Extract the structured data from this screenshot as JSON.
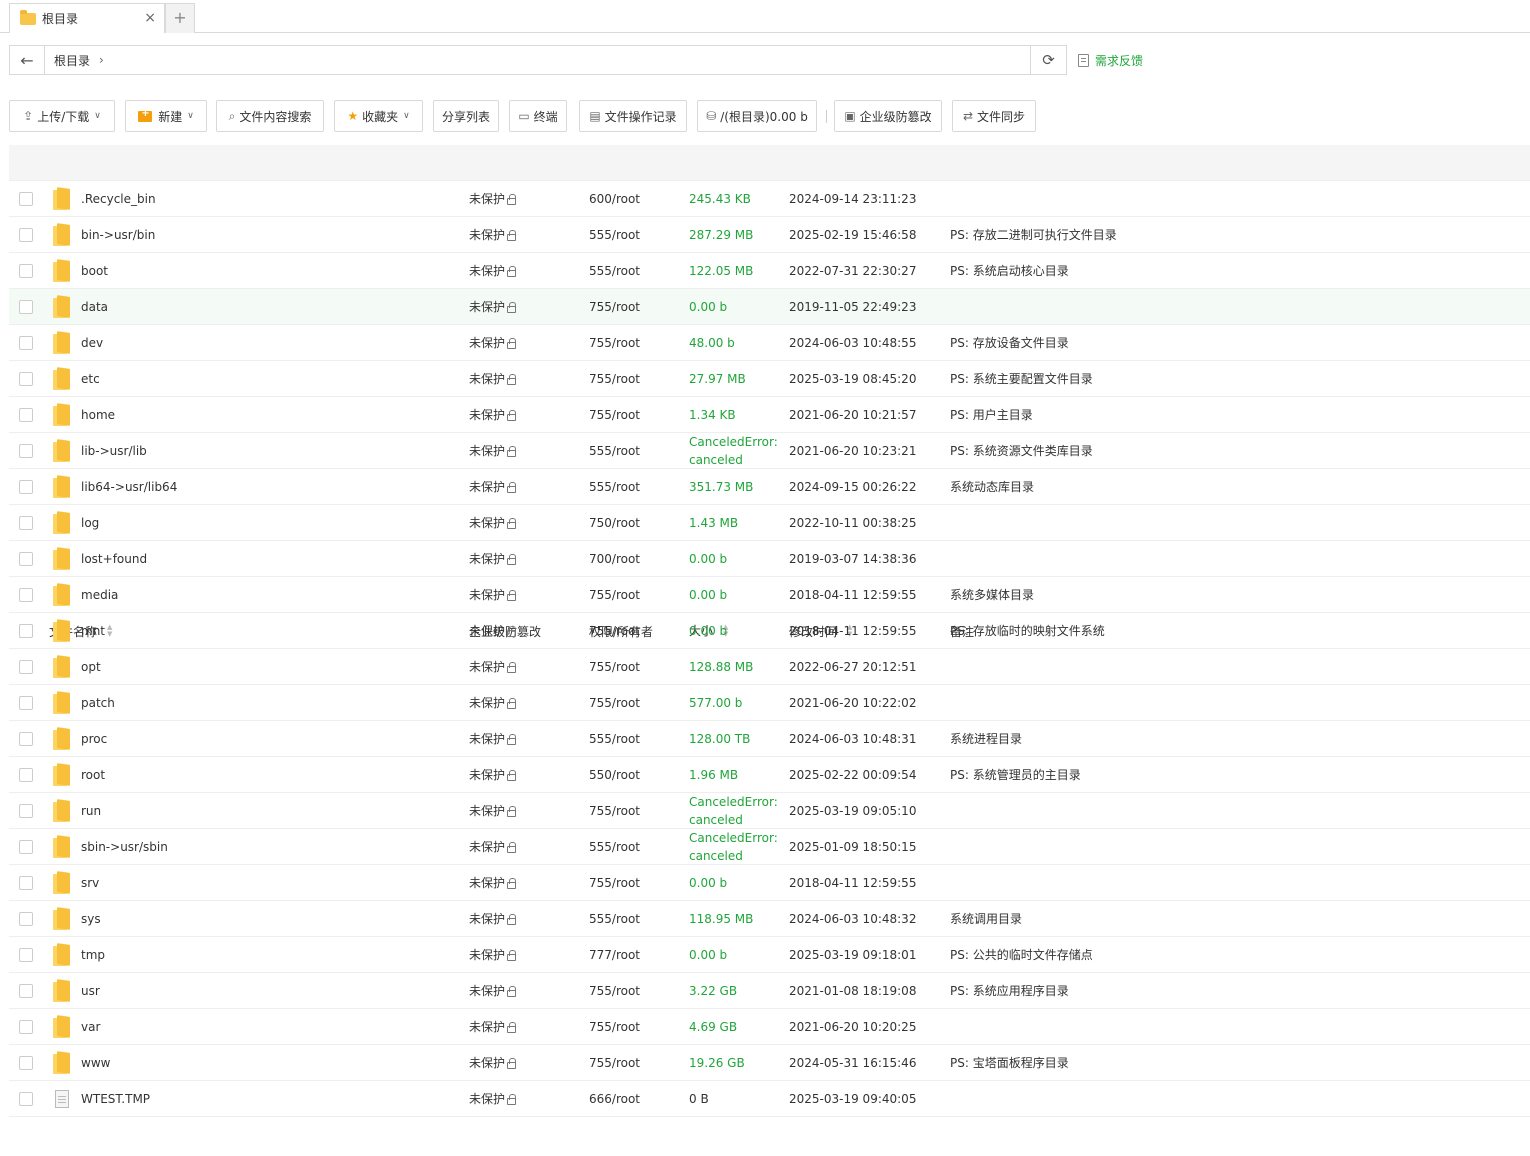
{
  "tab": {
    "label": "根目录",
    "close": "×",
    "add": "+"
  },
  "address": {
    "crumb": "根目录",
    "chev": "›",
    "back": "←",
    "refresh": "⟳"
  },
  "feedback": {
    "label": "需求反馈"
  },
  "toolbar": {
    "upload": "上传/下载",
    "new": "新建",
    "search": "文件内容搜索",
    "favorites": "收藏夹",
    "share_list": "分享列表",
    "terminal": "终端",
    "op_log": "文件操作记录",
    "disk": "/(根目录)0.00 b",
    "tamper": "企业级防篡改",
    "sync": "文件同步"
  },
  "columns": {
    "name": "文件名称",
    "tamper": "企业级防篡改",
    "perm": "权限/所有者",
    "size": "大小",
    "mtime": "修改时间",
    "note": "备注"
  },
  "rows": [
    {
      "name": ".Recycle_bin",
      "type": "folder",
      "tamper": "未保护",
      "perm": "600/root",
      "size": "245.43 KB",
      "mtime": "2024-09-14 23:11:23",
      "note": ""
    },
    {
      "name": "bin->usr/bin",
      "type": "folder",
      "tamper": "未保护",
      "perm": "555/root",
      "size": "287.29 MB",
      "mtime": "2025-02-19 15:46:58",
      "note": "PS: 存放二进制可执行文件目录"
    },
    {
      "name": "boot",
      "type": "folder",
      "tamper": "未保护",
      "perm": "555/root",
      "size": "122.05 MB",
      "mtime": "2022-07-31 22:30:27",
      "note": "PS: 系统启动核心目录"
    },
    {
      "name": "data",
      "type": "folder",
      "tamper": "未保护",
      "perm": "755/root",
      "size": "0.00 b",
      "mtime": "2019-11-05 22:49:23",
      "note": "",
      "highlight": true
    },
    {
      "name": "dev",
      "type": "folder",
      "tamper": "未保护",
      "perm": "755/root",
      "size": "48.00 b",
      "mtime": "2024-06-03 10:48:55",
      "note": "PS: 存放设备文件目录"
    },
    {
      "name": "etc",
      "type": "folder",
      "tamper": "未保护",
      "perm": "755/root",
      "size": "27.97 MB",
      "mtime": "2025-03-19 08:45:20",
      "note": "PS: 系统主要配置文件目录"
    },
    {
      "name": "home",
      "type": "folder",
      "tamper": "未保护",
      "perm": "755/root",
      "size": "1.34 KB",
      "mtime": "2021-06-20 10:21:57",
      "note": "PS: 用户主目录"
    },
    {
      "name": "lib->usr/lib",
      "type": "folder",
      "tamper": "未保护",
      "perm": "555/root",
      "size": "CanceledError: canceled",
      "mtime": "2021-06-20 10:23:21",
      "note": "PS: 系统资源文件类库目录"
    },
    {
      "name": "lib64->usr/lib64",
      "type": "folder",
      "tamper": "未保护",
      "perm": "555/root",
      "size": "351.73 MB",
      "mtime": "2024-09-15 00:26:22",
      "note": "系统动态库目录"
    },
    {
      "name": "log",
      "type": "folder",
      "tamper": "未保护",
      "perm": "750/root",
      "size": "1.43 MB",
      "mtime": "2022-10-11 00:38:25",
      "note": ""
    },
    {
      "name": "lost+found",
      "type": "folder",
      "tamper": "未保护",
      "perm": "700/root",
      "size": "0.00 b",
      "mtime": "2019-03-07 14:38:36",
      "note": ""
    },
    {
      "name": "media",
      "type": "folder",
      "tamper": "未保护",
      "perm": "755/root",
      "size": "0.00 b",
      "mtime": "2018-04-11 12:59:55",
      "note": "系统多媒体目录"
    },
    {
      "name": "mnt",
      "type": "folder",
      "tamper": "未保护",
      "perm": "755/root",
      "size": "0.00 b",
      "mtime": "2018-04-11 12:59:55",
      "note": "PS: 存放临时的映射文件系统"
    },
    {
      "name": "opt",
      "type": "folder",
      "tamper": "未保护",
      "perm": "755/root",
      "size": "128.88 MB",
      "mtime": "2022-06-27 20:12:51",
      "note": ""
    },
    {
      "name": "patch",
      "type": "folder",
      "tamper": "未保护",
      "perm": "755/root",
      "size": "577.00 b",
      "mtime": "2021-06-20 10:22:02",
      "note": ""
    },
    {
      "name": "proc",
      "type": "folder",
      "tamper": "未保护",
      "perm": "555/root",
      "size": "128.00 TB",
      "mtime": "2024-06-03 10:48:31",
      "note": "系统进程目录"
    },
    {
      "name": "root",
      "type": "folder",
      "tamper": "未保护",
      "perm": "550/root",
      "size": "1.96 MB",
      "mtime": "2025-02-22 00:09:54",
      "note": "PS: 系统管理员的主目录"
    },
    {
      "name": "run",
      "type": "folder",
      "tamper": "未保护",
      "perm": "755/root",
      "size": "CanceledError: canceled",
      "mtime": "2025-03-19 09:05:10",
      "note": ""
    },
    {
      "name": "sbin->usr/sbin",
      "type": "folder",
      "tamper": "未保护",
      "perm": "555/root",
      "size": "CanceledError: canceled",
      "mtime": "2025-01-09 18:50:15",
      "note": ""
    },
    {
      "name": "srv",
      "type": "folder",
      "tamper": "未保护",
      "perm": "755/root",
      "size": "0.00 b",
      "mtime": "2018-04-11 12:59:55",
      "note": ""
    },
    {
      "name": "sys",
      "type": "folder",
      "tamper": "未保护",
      "perm": "555/root",
      "size": "118.95 MB",
      "mtime": "2024-06-03 10:48:32",
      "note": "系统调用目录"
    },
    {
      "name": "tmp",
      "type": "folder",
      "tamper": "未保护",
      "perm": "777/root",
      "size": "0.00 b",
      "mtime": "2025-03-19 09:18:01",
      "note": "PS: 公共的临时文件存储点"
    },
    {
      "name": "usr",
      "type": "folder",
      "tamper": "未保护",
      "perm": "755/root",
      "size": "3.22 GB",
      "mtime": "2021-01-08 18:19:08",
      "note": "PS: 系统应用程序目录"
    },
    {
      "name": "var",
      "type": "folder",
      "tamper": "未保护",
      "perm": "755/root",
      "size": "4.69 GB",
      "mtime": "2021-06-20 10:20:25",
      "note": ""
    },
    {
      "name": "www",
      "type": "folder",
      "tamper": "未保护",
      "perm": "755/root",
      "size": "19.26 GB",
      "mtime": "2024-05-31 16:15:46",
      "note": "PS: 宝塔面板程序目录"
    },
    {
      "name": "WTEST.TMP",
      "type": "file",
      "tamper": "未保护",
      "perm": "666/root",
      "size": "0 B",
      "mtime": "2025-03-19 09:40:05",
      "note": ""
    }
  ],
  "colors": {
    "accent": "#20a53a",
    "highlight_row": "#f4faf5",
    "folder": "#f8c03a"
  },
  "icons": {
    "back": "arrow-left-icon",
    "refresh": "refresh-icon",
    "feedback": "edit-doc-icon",
    "folder": "folder-icon",
    "file": "file-icon",
    "lock": "lock-icon"
  }
}
